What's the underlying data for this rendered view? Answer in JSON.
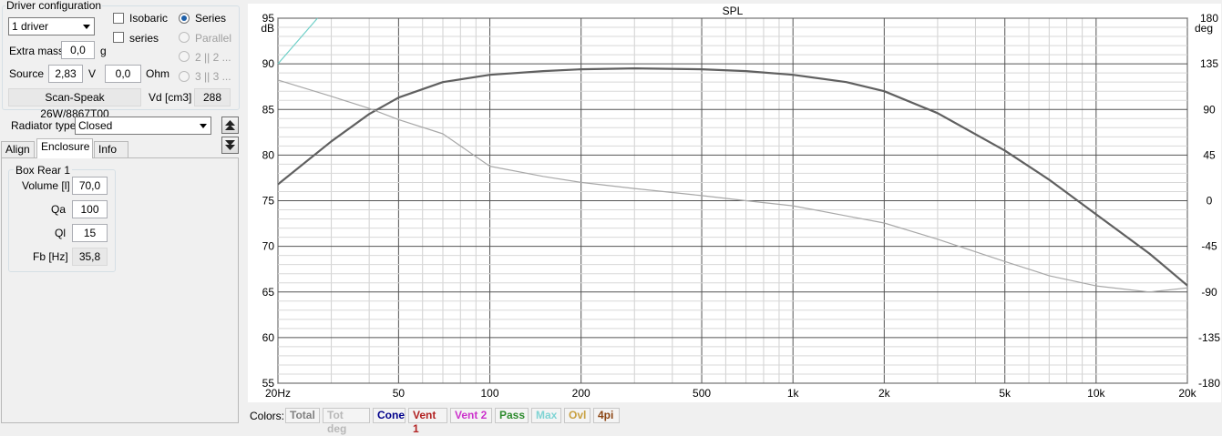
{
  "driver_config": {
    "title": "Driver configuration",
    "driver_count": "1 driver",
    "isobaric_label": "Isobaric",
    "series_check_label": "series",
    "radio_series": "Series",
    "radio_parallel": "Parallel",
    "radio_2": "2 || 2 ...",
    "radio_3": "3 || 3 ...",
    "extra_mass_label": "Extra mass",
    "extra_mass_value": "0,0",
    "extra_mass_unit": "g",
    "source_label": "Source",
    "source_v_value": "2,83",
    "source_v_unit": "V",
    "source_ohm_value": "0,0",
    "source_ohm_unit": "Ohm",
    "driver_name": "Scan-Speak 26W/8867T00",
    "vd_label": "Vd [cm3]",
    "vd_value": "288"
  },
  "radiator": {
    "label": "Radiator type",
    "value": "Closed"
  },
  "tabs": [
    "Align",
    "Enclosure",
    "Info"
  ],
  "box": {
    "title": "Box Rear 1",
    "volume_label": "Volume [l]",
    "volume_value": "70,0",
    "qa_label": "Qa",
    "qa_value": "100",
    "ql_label": "Ql",
    "ql_value": "15",
    "fb_label": "Fb [Hz]",
    "fb_value": "35,8"
  },
  "colors_label": "Colors:",
  "legend": [
    {
      "label": "Total",
      "color": "#808080"
    },
    {
      "label": "Tot deg",
      "color": "#b8b8b8"
    },
    {
      "label": "Cone",
      "color": "#00008b"
    },
    {
      "label": "Vent 1",
      "color": "#b22222"
    },
    {
      "label": "Vent 2",
      "color": "#cc33cc"
    },
    {
      "label": "Pass",
      "color": "#2e8b2e"
    },
    {
      "label": "Max",
      "color": "#7fd4d4"
    },
    {
      "label": "Ovl",
      "color": "#c8a040"
    },
    {
      "label": "4pi",
      "color": "#8b4513"
    }
  ],
  "chart_data": {
    "type": "line",
    "title": "SPL",
    "ylabel": "dB",
    "y2label": "deg",
    "xscale": "log",
    "xlim": [
      20,
      20000
    ],
    "ylim": [
      55,
      95
    ],
    "y2lim": [
      -180,
      180
    ],
    "x_ticks": [
      "20Hz",
      "50",
      "100",
      "200",
      "500",
      "1k",
      "2k",
      "5k",
      "10k",
      "20k"
    ],
    "y_ticks": [
      "95",
      "90",
      "85",
      "80",
      "75",
      "70",
      "65",
      "60",
      "55"
    ],
    "y2_ticks": [
      "180",
      "135",
      "90",
      "45",
      "0",
      "-45",
      "-90",
      "-135",
      "-180"
    ],
    "grid": true,
    "series": [
      {
        "color": "#606060",
        "axis": "left",
        "x": [
          20,
          30,
          40,
          50,
          70,
          100,
          150,
          200,
          300,
          500,
          700,
          1000,
          1500,
          2000,
          3000,
          5000,
          7000,
          10000,
          15000,
          20000
        ],
        "y": [
          76.8,
          81.5,
          84.5,
          86.3,
          88.0,
          88.8,
          89.2,
          89.4,
          89.5,
          89.4,
          89.2,
          88.8,
          88.0,
          87.0,
          84.6,
          80.5,
          77.3,
          73.5,
          69.2,
          65.7
        ]
      },
      {
        "color": "#a8a8a8",
        "axis": "right",
        "x": [
          20,
          30,
          40,
          50,
          70,
          100,
          150,
          200,
          300,
          500,
          700,
          1000,
          1500,
          2000,
          3000,
          5000,
          7000,
          10000,
          15000,
          20000
        ],
        "y": [
          119,
          103,
          91,
          80,
          66,
          34,
          24,
          18,
          12,
          5,
          0,
          -5,
          -15,
          -22,
          -38,
          -60,
          -74,
          -84,
          -90,
          -86
        ]
      },
      {
        "color": "#6fd0c8",
        "axis": "left",
        "x": [
          20,
          27
        ],
        "y": [
          90,
          95
        ]
      }
    ]
  }
}
